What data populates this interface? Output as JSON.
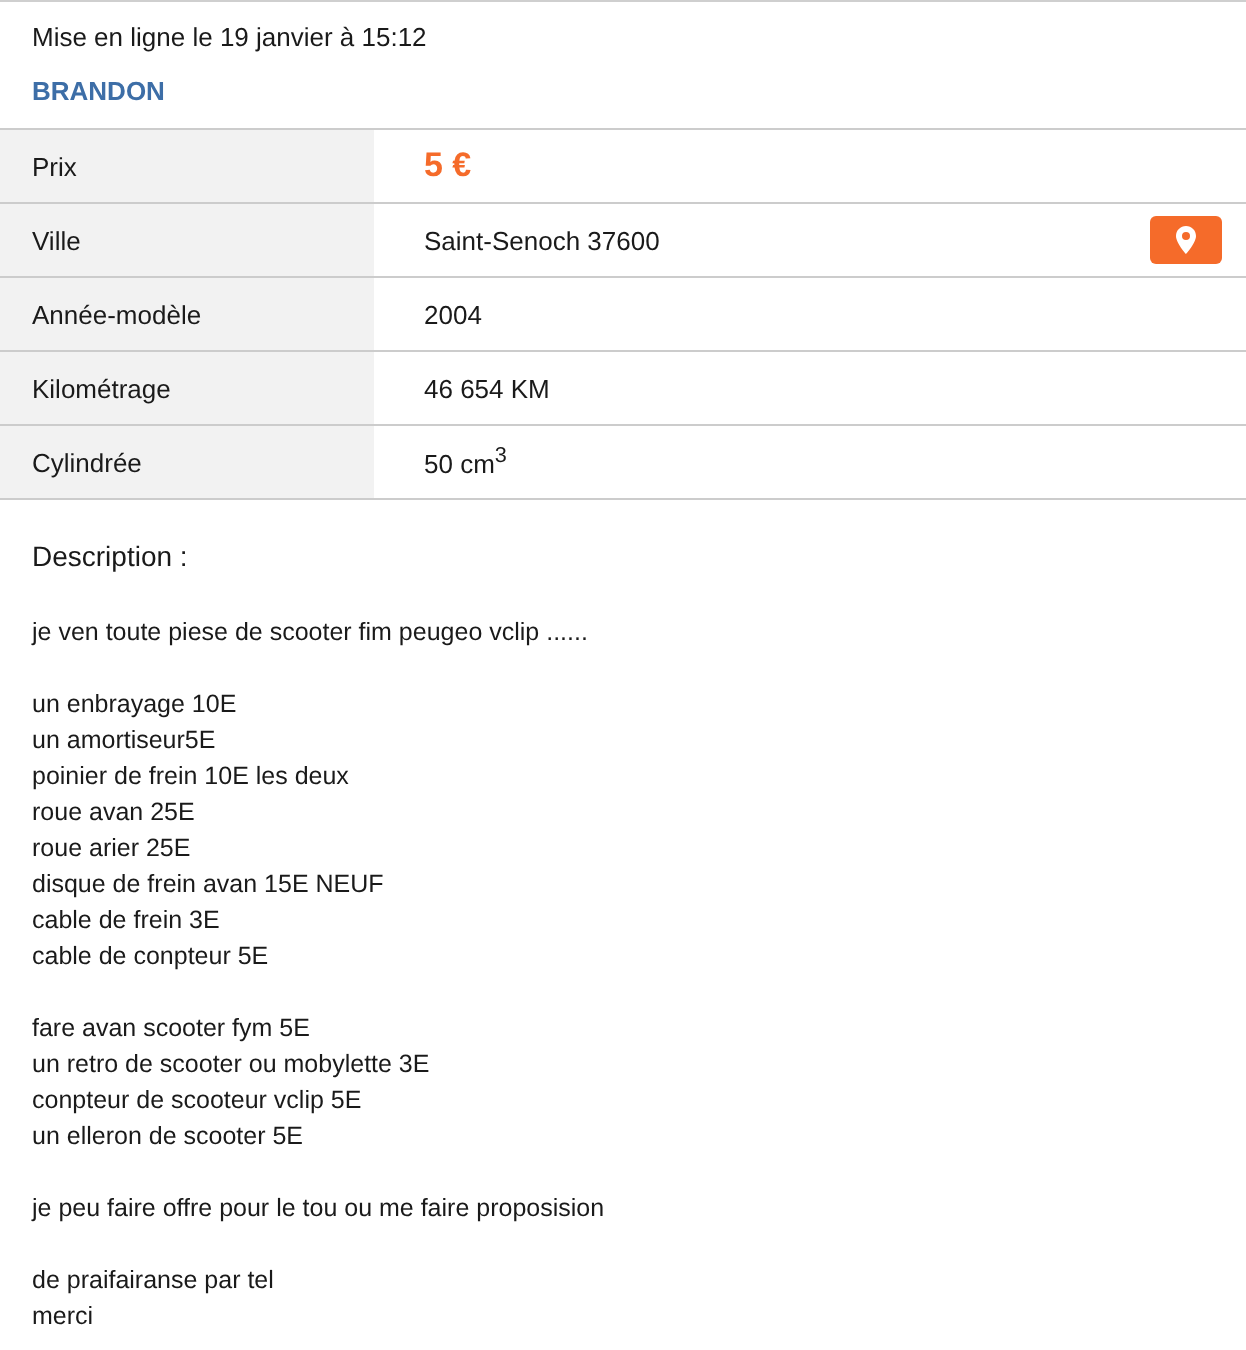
{
  "posted": "Mise en ligne le 19 janvier à 15:12",
  "seller": "BRANDON",
  "details": [
    {
      "label": "Prix",
      "value": "5 €",
      "kind": "price"
    },
    {
      "label": "Ville",
      "value": "Saint-Senoch 37600",
      "kind": "location"
    },
    {
      "label": "Année-modèle",
      "value": "2004",
      "kind": "text"
    },
    {
      "label": "Kilométrage",
      "value": "46 654 KM",
      "kind": "text"
    },
    {
      "label": "Cylindrée",
      "value": "50 cm$^{3}$",
      "kind": "text"
    }
  ],
  "description": {
    "title": "Description :",
    "paragraphs": [
      [
        "je ven toute piese de scooter fim peugeo vclip ......"
      ],
      [
        "un enbrayage 10E",
        "un amortiseur5E",
        "poinier de frein 10E les deux",
        "roue avan 25E",
        "roue arier 25E",
        "disque de frein avan 15E NEUF",
        "cable de frein 3E",
        "cable de conpteur 5E"
      ],
      [
        "fare avan scooter fym 5E",
        "un retro de scooter ou mobylette 3E",
        "conpteur de scooteur vclip 5E",
        "un elleron de scooter 5E"
      ],
      [
        "je peu faire offre pour le tou ou me faire proposision"
      ],
      [
        "de praifairanse par tel",
        "merci"
      ]
    ]
  }
}
